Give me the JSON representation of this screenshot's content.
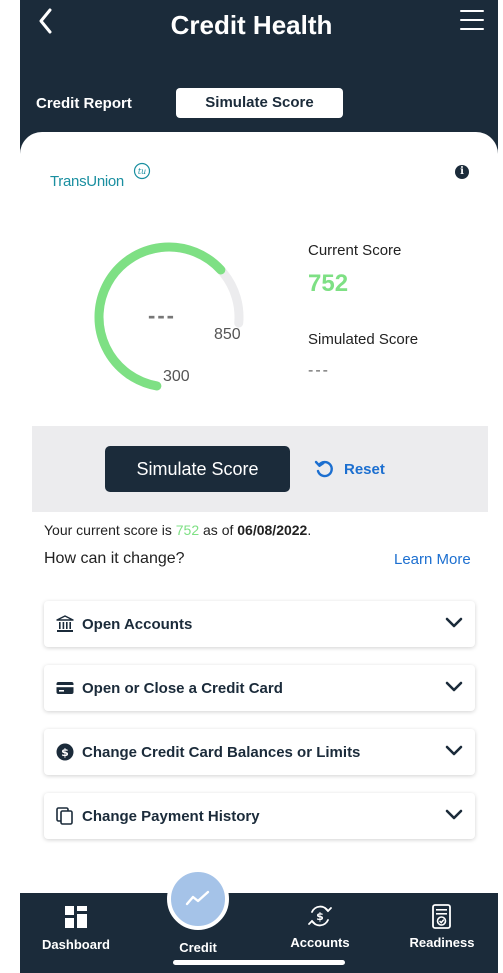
{
  "header": {
    "title": "Credit Health",
    "tabs": [
      {
        "label": "Credit Report",
        "active": false
      },
      {
        "label": "Simulate Score",
        "active": true
      }
    ]
  },
  "bureau": {
    "logo_text": "TransUnion",
    "logo_mark": "tu"
  },
  "gauge": {
    "placeholder": "---",
    "min_label": "300",
    "max_label": "850",
    "min": 300,
    "max": 850,
    "value": 752
  },
  "scores": {
    "current_label": "Current Score",
    "current_value": "752",
    "simulated_label": "Simulated Score",
    "simulated_value": "---"
  },
  "actions": {
    "simulate_label": "Simulate Score",
    "reset_label": "Reset"
  },
  "summary": {
    "prefix": "Your current score is",
    "score": "752",
    "as_of": "as of",
    "date": "06/08/2022",
    "period": ".",
    "question": "How can it change?",
    "learn_more": "Learn More"
  },
  "factors": [
    {
      "label": "Open Accounts",
      "icon": "bank-icon"
    },
    {
      "label": "Open or Close a Credit Card",
      "icon": "credit-card-icon"
    },
    {
      "label": "Change Credit Card Balances or Limits",
      "icon": "dollar-circle-icon"
    },
    {
      "label": "Change Payment History",
      "icon": "document-copy-icon"
    }
  ],
  "nav": [
    {
      "label": "Dashboard",
      "icon": "dashboard-icon"
    },
    {
      "label": "Credit",
      "icon": "trend-line-icon",
      "active": true
    },
    {
      "label": "Accounts",
      "icon": "dollar-cycle-icon"
    },
    {
      "label": "Readiness",
      "icon": "checklist-icon"
    }
  ],
  "colors": {
    "navy": "#1b2b3a",
    "score_green": "#7ee084",
    "link_blue": "#1c6fd0",
    "brand_teal": "#1a8fa0"
  }
}
